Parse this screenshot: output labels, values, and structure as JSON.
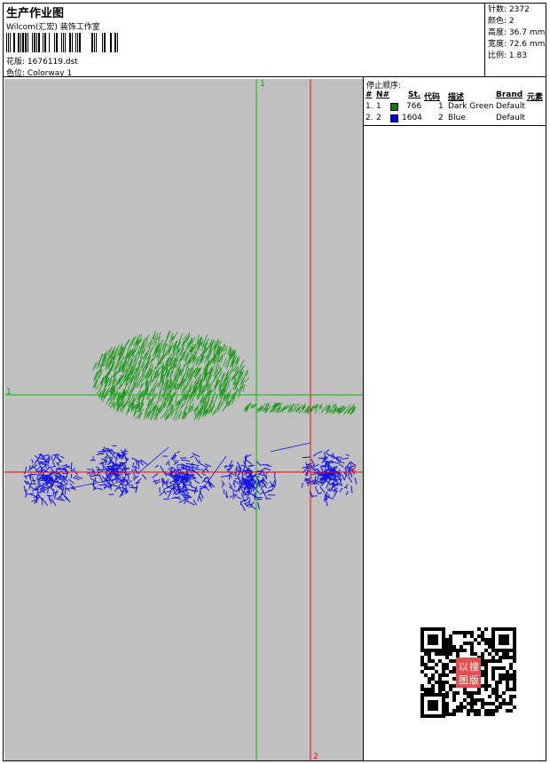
{
  "header": {
    "title": "生产作业图",
    "studio": "Wilcom(汇宏) 装饰工作室",
    "design_label": "花版:",
    "design_value": "1676119.dst",
    "colorway_label": "色位:",
    "colorway_value": "Colorway 1"
  },
  "stats": [
    {
      "label": "针数:",
      "value": "2372"
    },
    {
      "label": "颜色:",
      "value": "2"
    },
    {
      "label": "高度:",
      "value": "36.7 mm"
    },
    {
      "label": "宽度:",
      "value": "72.6 mm"
    },
    {
      "label": "比例:",
      "value": "1.83"
    }
  ],
  "stop_sequence": {
    "title": "停止顺序:",
    "columns": [
      "#",
      "N#",
      "St.",
      "代码",
      "描述",
      "Brand",
      "元素"
    ],
    "rows": [
      {
        "num": "1.",
        "needle": "1",
        "stitches": "766",
        "code": "1",
        "desc": "Dark Green",
        "brand": "Default",
        "color": "#008000"
      },
      {
        "num": "2.",
        "needle": "2",
        "stitches": "1604",
        "code": "2",
        "desc": "Blue",
        "brand": "Default",
        "color": "#0000ff"
      }
    ]
  },
  "canvas": {
    "background": "#c0c0c0",
    "guide_green_label_top": "1",
    "guide_green_label_left": "1",
    "guide_red_label_right": "2",
    "guide_red_label_bottom": "2",
    "green_color": "#00c000",
    "red_color": "#ff0000",
    "stitch_green": "#1a9a1a",
    "stitch_blue": "#1414e6"
  },
  "qr": {
    "stamp_text": [
      "以",
      "图",
      "搜",
      "版"
    ],
    "stamp_color": "#e84c4c"
  }
}
